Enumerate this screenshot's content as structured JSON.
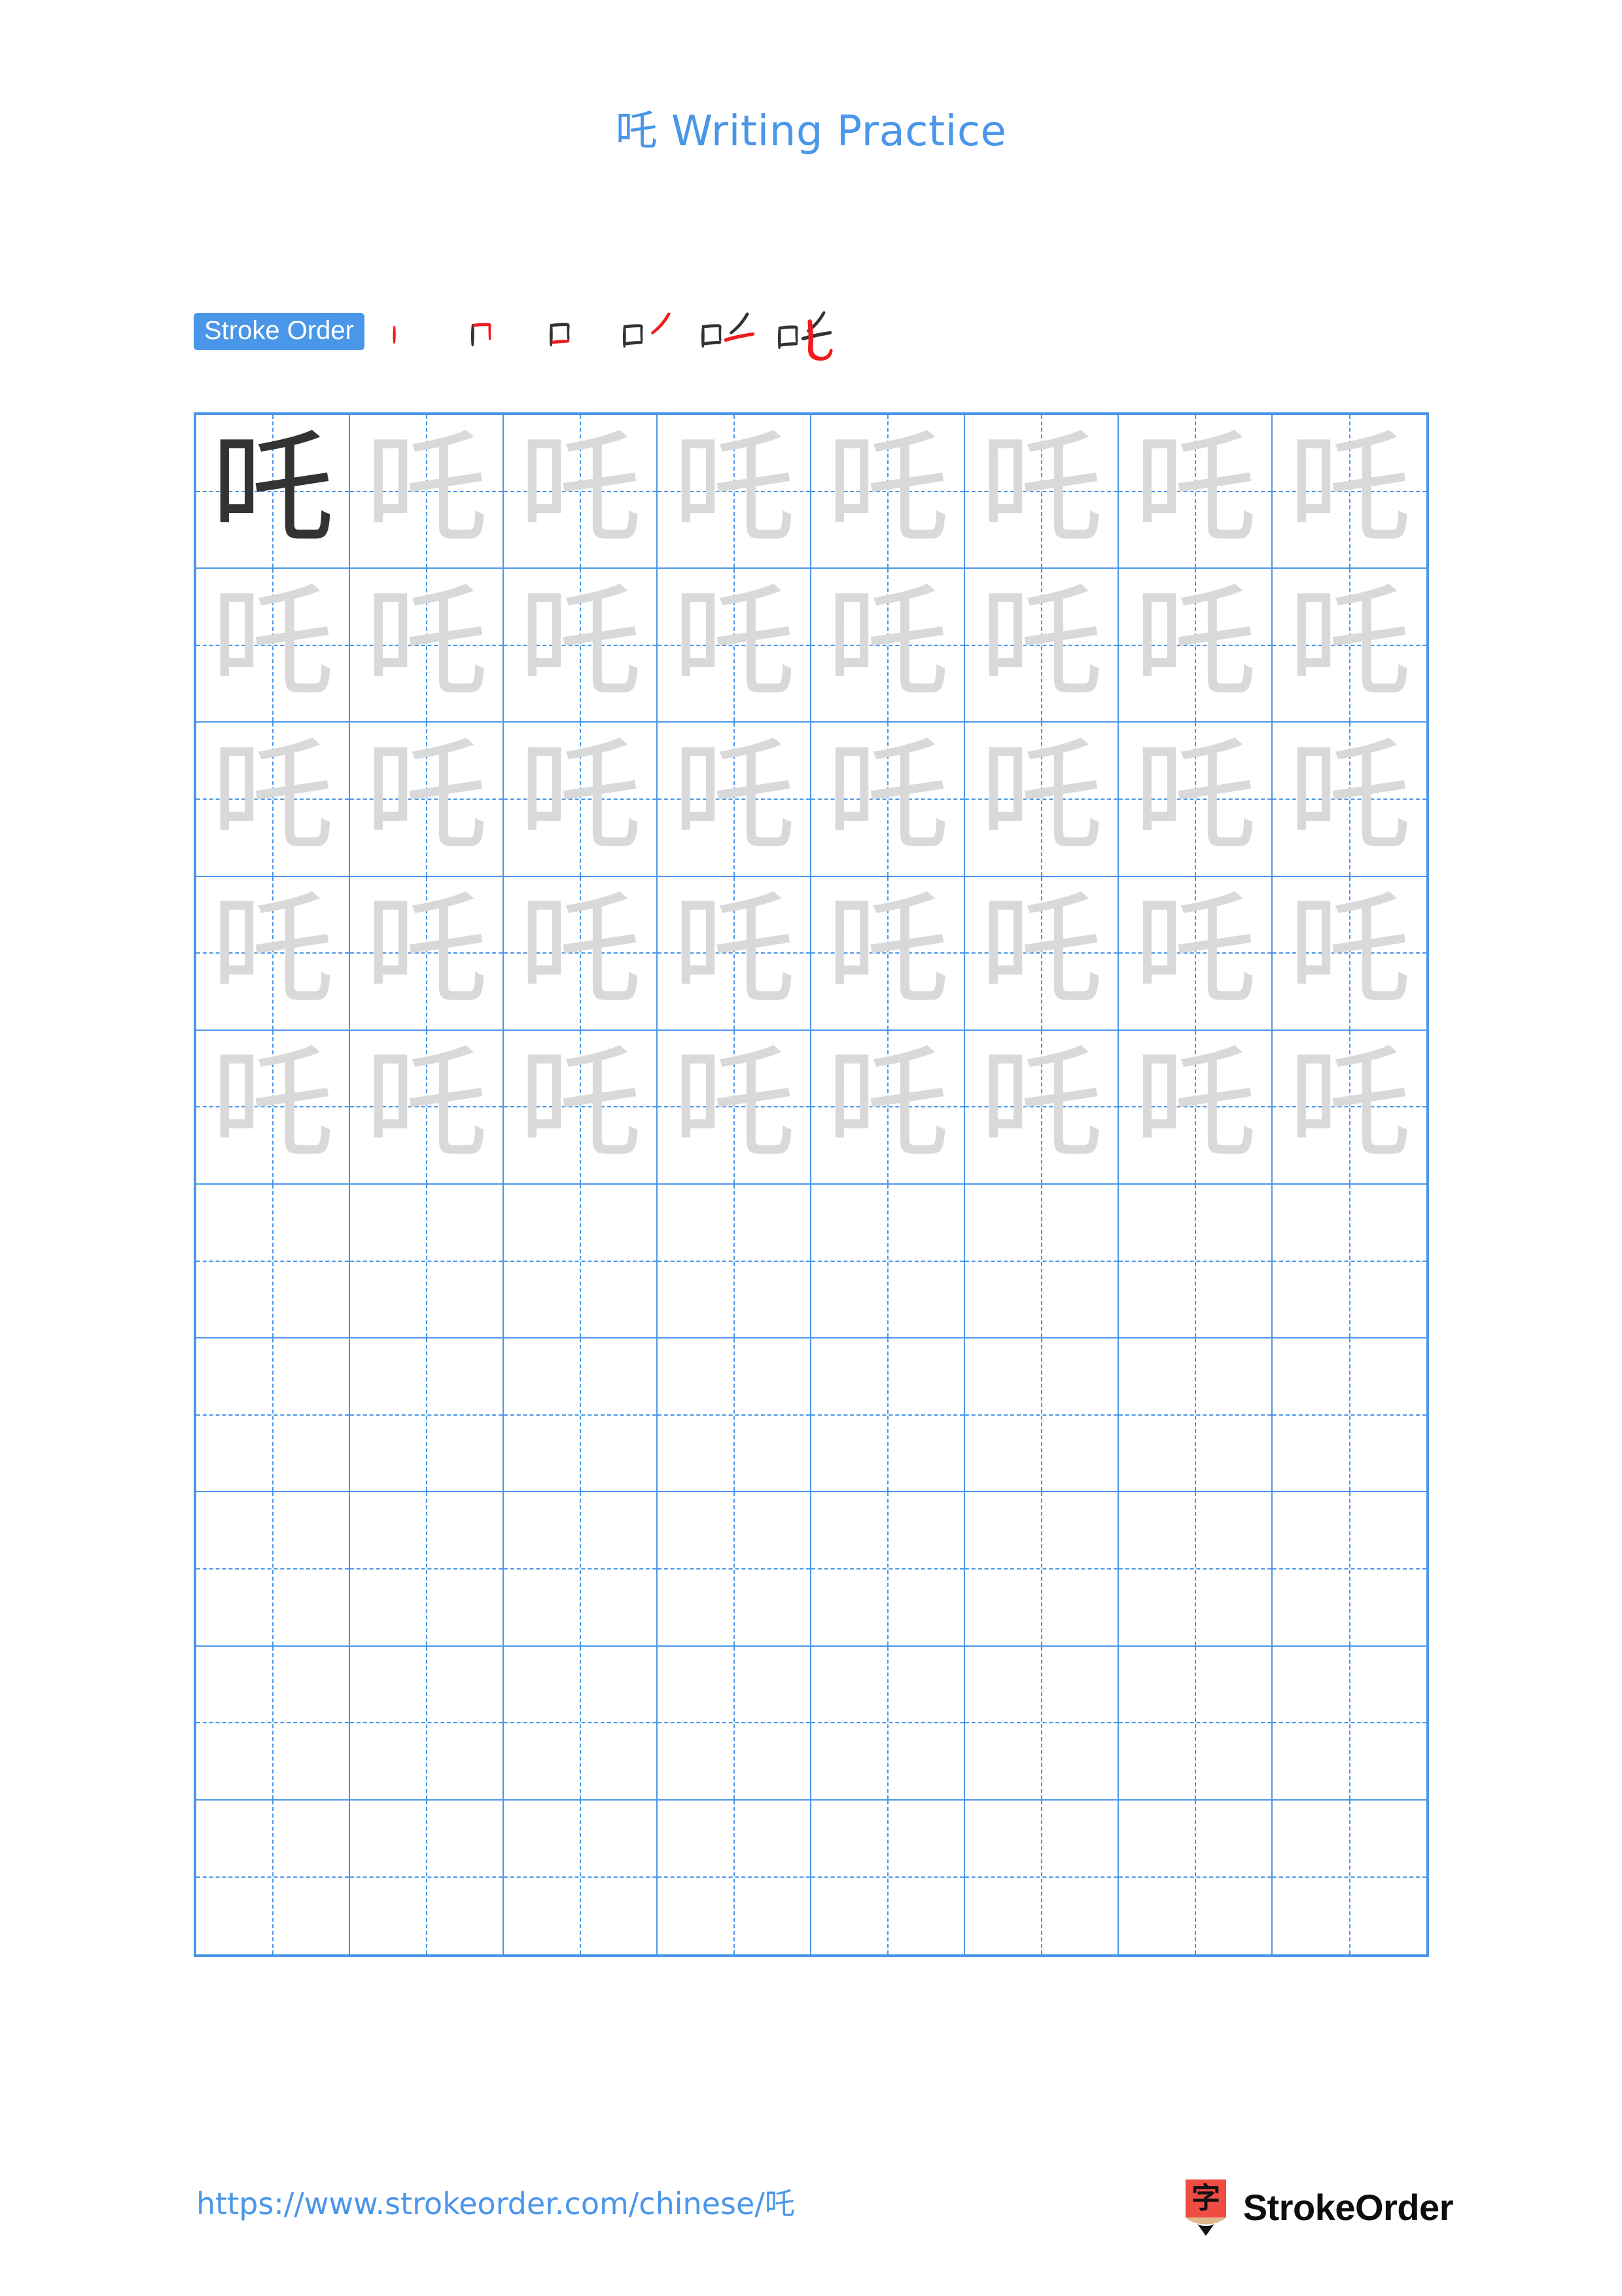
{
  "page": {
    "character": "吒",
    "title": "吒 Writing Practice",
    "background_color": "#ffffff"
  },
  "stroke_order": {
    "badge_label": "Stroke Order",
    "badge_bg_color": "#4a96e8",
    "badge_text_color": "#ffffff",
    "prior_stroke_color": "#333333",
    "new_stroke_color": "#ee1c1c",
    "total_strokes": 6,
    "steps": [
      {
        "index": 1,
        "strokes_shown": 1,
        "new_stroke": "竖 (vertical)"
      },
      {
        "index": 2,
        "strokes_shown": 2,
        "new_stroke": "横折 (horizontal-turn)"
      },
      {
        "index": 3,
        "strokes_shown": 3,
        "new_stroke": "横 (horizontal)"
      },
      {
        "index": 4,
        "strokes_shown": 4,
        "new_stroke": "撇 (left-falling)"
      },
      {
        "index": 5,
        "strokes_shown": 5,
        "new_stroke": "横 (horizontal)"
      },
      {
        "index": 6,
        "strokes_shown": 6,
        "new_stroke": "竖弯钩 (vertical-bend-hook)"
      }
    ]
  },
  "grid": {
    "columns": 8,
    "rows": 10,
    "line_color": "#4a96e8",
    "guide_color": "#4a96e8",
    "model_glyph_color": "#333333",
    "trace_glyph_color": "#d9d9d9",
    "cells": [
      [
        "model",
        "trace",
        "trace",
        "trace",
        "trace",
        "trace",
        "trace",
        "trace"
      ],
      [
        "trace",
        "trace",
        "trace",
        "trace",
        "trace",
        "trace",
        "trace",
        "trace"
      ],
      [
        "trace",
        "trace",
        "trace",
        "trace",
        "trace",
        "trace",
        "trace",
        "trace"
      ],
      [
        "trace",
        "trace",
        "trace",
        "trace",
        "trace",
        "trace",
        "trace",
        "trace"
      ],
      [
        "trace",
        "trace",
        "trace",
        "trace",
        "trace",
        "trace",
        "trace",
        "trace"
      ],
      [
        "blank",
        "blank",
        "blank",
        "blank",
        "blank",
        "blank",
        "blank",
        "blank"
      ],
      [
        "blank",
        "blank",
        "blank",
        "blank",
        "blank",
        "blank",
        "blank",
        "blank"
      ],
      [
        "blank",
        "blank",
        "blank",
        "blank",
        "blank",
        "blank",
        "blank",
        "blank"
      ],
      [
        "blank",
        "blank",
        "blank",
        "blank",
        "blank",
        "blank",
        "blank",
        "blank"
      ],
      [
        "blank",
        "blank",
        "blank",
        "blank",
        "blank",
        "blank",
        "blank",
        "blank"
      ]
    ]
  },
  "footer": {
    "url_text": "https://www.strokeorder.com/chinese/吒",
    "url_color": "#4a96e8",
    "brand_name": "StrokeOrder",
    "brand_name_color": "#0d0d0d",
    "logo_glyph": "字",
    "logo_body_color": "#ef4d44",
    "logo_wood_color": "#e0b88d",
    "logo_tip_color": "#111111"
  }
}
